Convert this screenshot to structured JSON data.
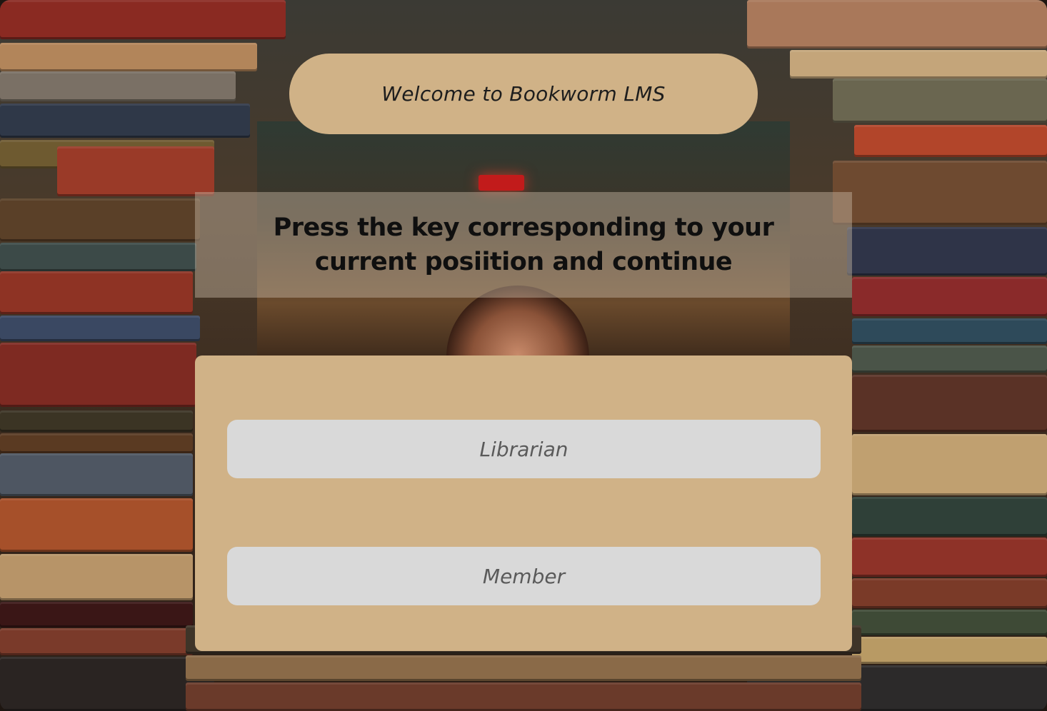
{
  "header": {
    "welcome_text": "Welcome to Bookworm LMS"
  },
  "prompt": {
    "text": "Press the key corresponding to your current posiition and continue"
  },
  "roles": {
    "librarian_label": "Librarian",
    "member_label": "Member"
  },
  "colors": {
    "panel_tan": "#d0b287",
    "button_gray": "#d9d9d9",
    "button_text": "#5a5a5a",
    "prompt_band": "rgba(200,185,165,0.45)"
  },
  "background": {
    "image": "stacked-old-books-background"
  }
}
